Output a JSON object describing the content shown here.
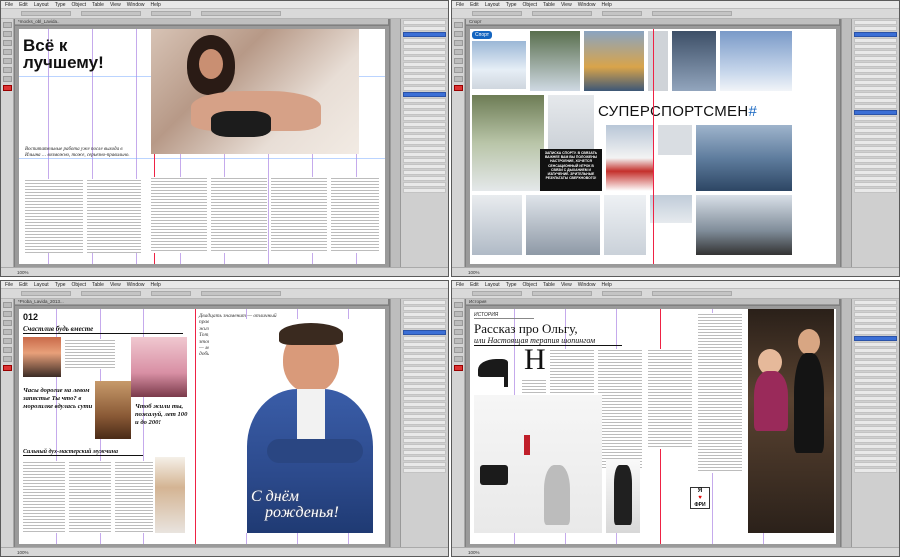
{
  "menu": [
    "File",
    "Edit",
    "Layout",
    "Type",
    "Object",
    "Table",
    "View",
    "Window",
    "Help"
  ],
  "status_zoom": "100%",
  "panes": [
    {
      "doc_tab": "*mocks_obl_Lavida..",
      "headline": "Всё к лучшему!",
      "subtitle_italic": "Воспитательные работа уже после выхода в Ильина … возможно, тоже, серьезно-правильно.",
      "colors": {
        "accent": "#1e90ff"
      }
    },
    {
      "doc_tab": "Спорт",
      "section_tag": "Спорт",
      "headline": "СУПЕРСПОРТСМЕН",
      "headline_mark": "#",
      "callout": "ЗАПИСКА СПОРТУ. В СВЯЗАТЬ ВАЖНЕЕ ВАМ ВЫ ПОЛОЖЕНЫ НАСТРОЕНИЕ, ХОЧЕТСЯ СЕНСАЦИОННЫЙ ИГРОК В СВЯЗИ С ДЫХАНИЕМ И ИЗЛУЧЕНИЕ. ЗРИТЕЛЬНЫЕ РЕЗУЛЬТАТЫ СВЕРХНОВОГО!"
    },
    {
      "doc_tab": "*Proba_Lavida_2013...",
      "page_number": "012",
      "headline": "Счастлив будь вместе",
      "quote_left": "Часы дорогие на левом запястье Ты что? в морозилке вдулась сути",
      "quote_right": "Чтоб жили ты, пожалуй, лет 100 и до 200!",
      "section_bottom": "Сильный дух-мастерский мужчина",
      "script_lines": [
        "С днём",
        "рожденья!"
      ],
      "intro_italic": "Двадцать знаменит — отличный правильный возраст, когда из жизни добиваться своей судьбы. Тот, кто немного отличится, в этот момент кто-то из нас это — можно — то и вообще они добиться больше сами к своему."
    },
    {
      "doc_tab": "История",
      "section_tag": "ИСТОРИЯ",
      "headline": "Рассказ про Ольгу,",
      "subhead": "или Настоящая терапия шопингом",
      "dropcap": "Н",
      "badge_line1": "Я",
      "badge_line2": "ФРИ"
    }
  ]
}
